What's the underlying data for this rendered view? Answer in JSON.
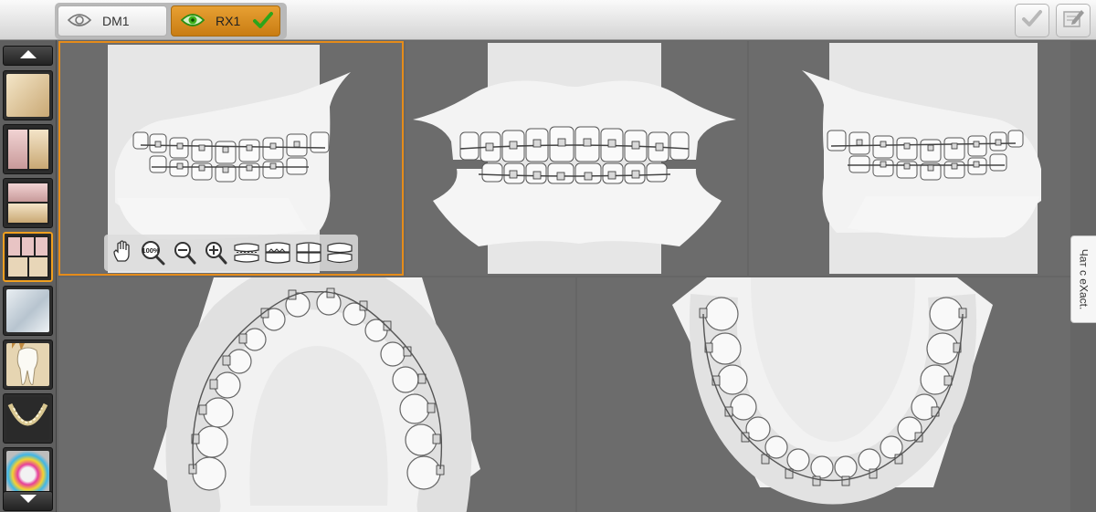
{
  "tabs": [
    {
      "label": "DM1",
      "icon": "eye-icon",
      "active": false
    },
    {
      "label": "RX1",
      "icon": "eye-icon",
      "active": true,
      "status_icon": "check-icon"
    }
  ],
  "top_actions": [
    {
      "icon": "check-icon"
    },
    {
      "icon": "edit-note-icon"
    }
  ],
  "sidebar": {
    "scroll_up_icon": "arrow-up-icon",
    "scroll_down_icon": "arrow-down-icon",
    "items": [
      {
        "icon": "layout-single-icon"
      },
      {
        "icon": "layout-two-columns-icon"
      },
      {
        "icon": "layout-two-rows-icon"
      },
      {
        "icon": "layout-five-views-icon",
        "active": true
      },
      {
        "icon": "glass-view-icon"
      },
      {
        "icon": "tooth-icon"
      },
      {
        "icon": "panoramic-xray-icon"
      },
      {
        "icon": "color-map-icon"
      }
    ]
  },
  "view_toolbar": {
    "items": [
      {
        "icon": "pan-hand-icon"
      },
      {
        "icon": "zoom-100-icon",
        "label": "100%"
      },
      {
        "icon": "zoom-out-icon"
      },
      {
        "icon": "zoom-in-icon"
      },
      {
        "icon": "open-bite-view-icon"
      },
      {
        "icon": "jaws-closed-icon"
      },
      {
        "icon": "jaws-side-icon"
      },
      {
        "icon": "jaws-front-icon"
      }
    ]
  },
  "viewports": [
    {
      "name": "right-buccal-view",
      "selected": true
    },
    {
      "name": "frontal-view"
    },
    {
      "name": "left-buccal-view"
    },
    {
      "name": "maxillary-occlusal-view"
    },
    {
      "name": "mandibular-occlusal-view"
    }
  ],
  "chat": {
    "label": "Чат с eXact."
  },
  "colors": {
    "accent": "#e58c1a",
    "active_tab": "#d88c22",
    "check": "#3db21b",
    "viewport_bg": "#6c6c6c",
    "model": "#f2f2f2"
  }
}
